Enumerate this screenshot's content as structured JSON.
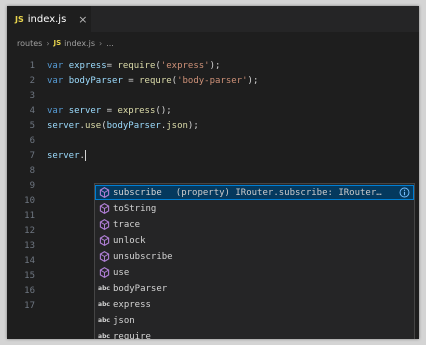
{
  "tab": {
    "icon": "JS",
    "filename": "index.js",
    "close": "×"
  },
  "breadcrumb": {
    "folder": "routes",
    "icon": "JS",
    "file": "index.js",
    "more": "..."
  },
  "editor": {
    "lines": [
      {
        "n": "1",
        "t": [
          [
            "kw",
            "var "
          ],
          [
            "var",
            "express"
          ],
          [
            "",
            "= "
          ],
          [
            "fn",
            "require"
          ],
          [
            "",
            "("
          ],
          [
            "str",
            "'express'"
          ],
          [
            "",
            ");"
          ]
        ]
      },
      {
        "n": "2",
        "t": [
          [
            "kw",
            "var "
          ],
          [
            "var",
            "bodyParser"
          ],
          [
            "",
            " = "
          ],
          [
            "fn",
            "requre"
          ],
          [
            "",
            "("
          ],
          [
            "str",
            "'body-parser'"
          ],
          [
            "",
            ");"
          ]
        ]
      },
      {
        "n": "3",
        "t": []
      },
      {
        "n": "4",
        "t": [
          [
            "kw",
            "var "
          ],
          [
            "var",
            "server"
          ],
          [
            "",
            " = "
          ],
          [
            "fn",
            "express"
          ],
          [
            "",
            "();"
          ]
        ]
      },
      {
        "n": "5",
        "t": [
          [
            "var",
            "server"
          ],
          [
            "",
            "."
          ],
          [
            "fn",
            "use"
          ],
          [
            "",
            "("
          ],
          [
            "var",
            "bodyParser"
          ],
          [
            "",
            "."
          ],
          [
            "fn",
            "json"
          ],
          [
            "",
            ");"
          ]
        ]
      },
      {
        "n": "6",
        "t": []
      },
      {
        "n": "7",
        "t": [
          [
            "var",
            "server"
          ],
          [
            "",
            "."
          ]
        ],
        "cursor": true
      },
      {
        "n": "8",
        "t": []
      },
      {
        "n": "9",
        "t": []
      },
      {
        "n": "10",
        "t": []
      },
      {
        "n": "11",
        "t": []
      },
      {
        "n": "12",
        "t": []
      },
      {
        "n": "13",
        "t": []
      },
      {
        "n": "14",
        "t": []
      },
      {
        "n": "15",
        "t": []
      },
      {
        "n": "16",
        "t": []
      },
      {
        "n": "17",
        "t": []
      }
    ]
  },
  "suggest": {
    "items": [
      {
        "kind": "method",
        "label": "subscribe",
        "detail": "(property) IRouter.subscribe: IRouter…",
        "selected": true
      },
      {
        "kind": "method",
        "label": "toString",
        "detail": ""
      },
      {
        "kind": "method",
        "label": "trace",
        "detail": ""
      },
      {
        "kind": "method",
        "label": "unlock",
        "detail": ""
      },
      {
        "kind": "method",
        "label": "unsubscribe",
        "detail": ""
      },
      {
        "kind": "method",
        "label": "use",
        "detail": ""
      },
      {
        "kind": "word",
        "label": "bodyParser",
        "detail": ""
      },
      {
        "kind": "word",
        "label": "express",
        "detail": ""
      },
      {
        "kind": "word",
        "label": "json",
        "detail": ""
      },
      {
        "kind": "word",
        "label": "require",
        "detail": ""
      }
    ],
    "word_icon": "abc"
  },
  "colors": {
    "keyword": "#569cd6",
    "variable": "#9cdcfe",
    "function": "#dcdcaa",
    "string": "#ce9178",
    "method_icon": "#b180d7",
    "js_icon": "#e8d44d",
    "selection": "#04395e",
    "match": "#18a3ff"
  },
  "icons": {
    "js": "js-file-icon",
    "close": "close-icon",
    "method": "method-cube-icon",
    "word": "text-word-icon",
    "info": "info-icon",
    "chevron": "chevron-right-icon"
  }
}
